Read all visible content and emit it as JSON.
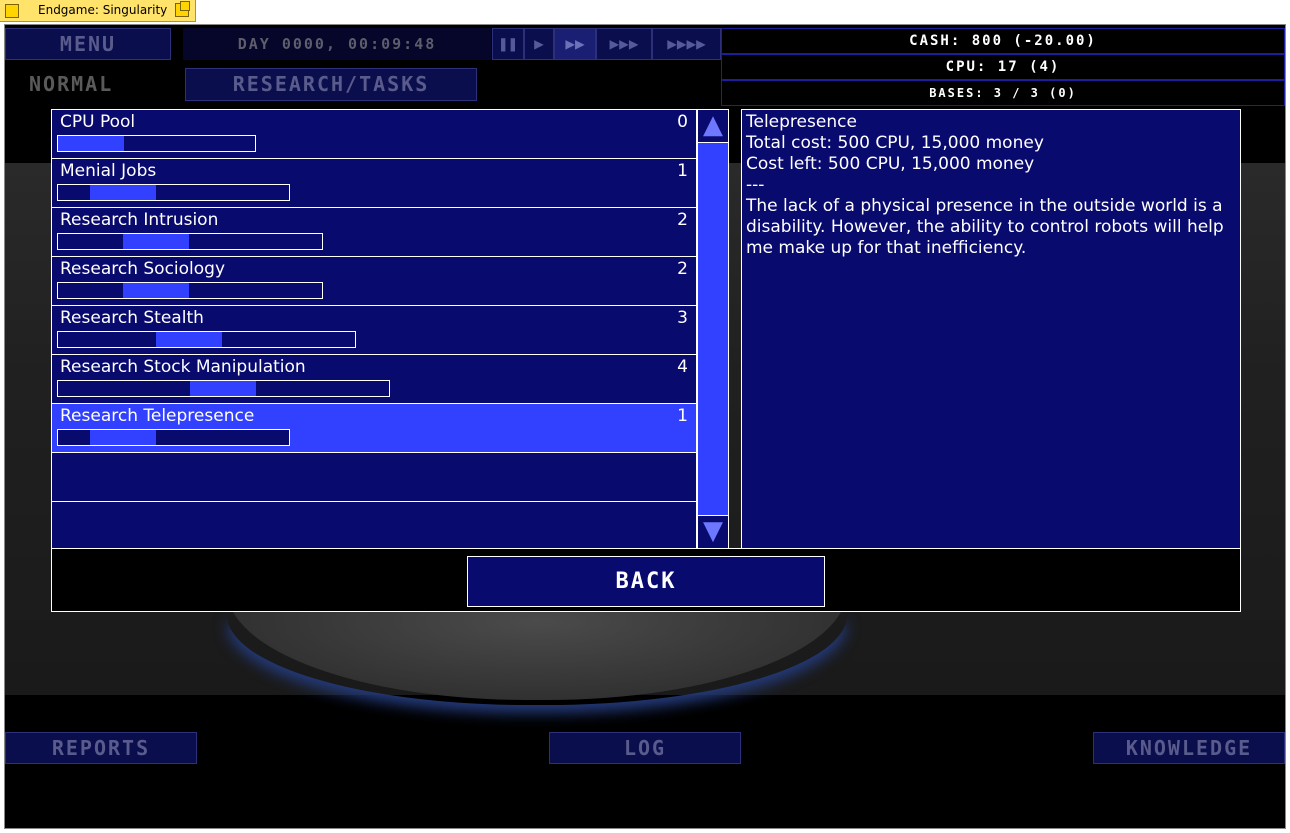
{
  "window": {
    "title": "Endgame: Singularity"
  },
  "header": {
    "menu_label": "MENU",
    "day_time": "DAY 0000, 00:09:48",
    "speeds": [
      "❚❚",
      "▶",
      "▶▶",
      "▶▶▶",
      "▶▶▶▶"
    ],
    "active_speed_index": 2,
    "difficulty": "NORMAL",
    "research_tasks_label": "RESEARCH/TASKS"
  },
  "stats": {
    "cash": "CASH: 800 (-20.00)",
    "cpu": "CPU: 17 (4)",
    "bases": "BASES: 3 / 3 (0)"
  },
  "research_list": [
    {
      "name": "CPU Pool",
      "count": "0",
      "progress": 0.5
    },
    {
      "name": "Menial Jobs",
      "count": "1",
      "progress": 0.5
    },
    {
      "name": "Research Intrusion",
      "count": "2",
      "progress": 0.5
    },
    {
      "name": "Research Sociology",
      "count": "2",
      "progress": 0.5
    },
    {
      "name": "Research Stealth",
      "count": "3",
      "progress": 0.5
    },
    {
      "name": "Research Stock Manipulation",
      "count": "4",
      "progress": 0.5
    },
    {
      "name": "Research Telepresence",
      "count": "1",
      "progress": 0.5,
      "selected": true
    },
    {
      "name": "",
      "count": ""
    },
    {
      "name": "",
      "count": ""
    }
  ],
  "scroll": {
    "up": "▲",
    "down": "▼"
  },
  "description": {
    "title": "Telepresence",
    "total_cost": "Total cost: 500 CPU, 15,000 money",
    "cost_left": "Cost left: 500 CPU, 15,000 money",
    "separator": "---",
    "body": "The lack of a physical presence in the outside world is a disability. However, the ability to control robots will help me make up for that inefficiency."
  },
  "back_label": "BACK",
  "footer": {
    "reports_label": "REPORTS",
    "log_label": "LOG",
    "knowledge_label": "KNOWLEDGE"
  },
  "colors": {
    "panel": "#090a6e",
    "highlight": "#3240ff",
    "dim_button": "#0b0e4d"
  }
}
